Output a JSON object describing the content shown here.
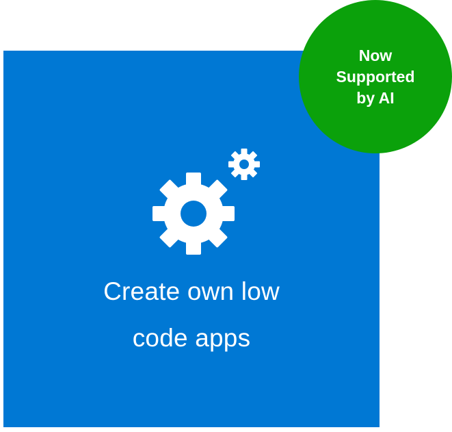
{
  "tile": {
    "label_line1": "Create own low",
    "label_line2": "code apps",
    "icon": "gear-icon",
    "background_color": "#0078D4"
  },
  "badge": {
    "line1": "Now",
    "line2": "Supported",
    "line3": "by AI",
    "background_color": "#0BA10B"
  }
}
